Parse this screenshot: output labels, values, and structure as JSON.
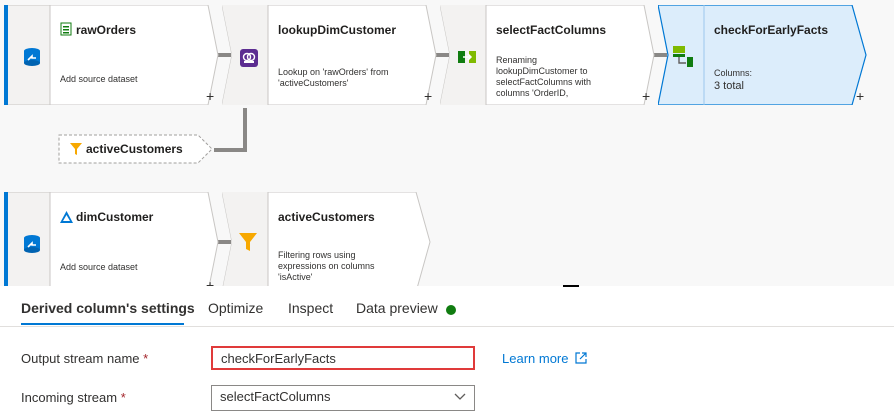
{
  "nodes": {
    "raw_orders": {
      "title": "rawOrders",
      "description": "Add source dataset"
    },
    "lookup": {
      "title": "lookupDimCustomer",
      "description": "Lookup on 'rawOrders' from 'activeCustomers'"
    },
    "select": {
      "title": "selectFactColumns",
      "description": "Renaming lookupDimCustomer to selectFactColumns with columns 'OrderID, CustomerKey, OrderDate..."
    },
    "check": {
      "title": "checkForEarlyFacts",
      "description_label": "Columns:",
      "description_value": "3 total"
    },
    "dim_customer": {
      "title": "dimCustomer",
      "description": "Add source dataset"
    },
    "active_customers": {
      "title": "activeCustomers",
      "description": "Filtering rows using expressions on columns 'isActive'"
    }
  },
  "reference_tag": {
    "label": "activeCustomers"
  },
  "plus_symbol": "+",
  "tabs": [
    {
      "label": "Derived column's settings",
      "active": true
    },
    {
      "label": "Optimize",
      "active": false
    },
    {
      "label": "Inspect",
      "active": false
    },
    {
      "label": "Data preview",
      "active": false
    }
  ],
  "form": {
    "output_stream_label": "Output stream name",
    "output_stream_value": "checkForEarlyFacts",
    "incoming_stream_label": "Incoming stream",
    "incoming_stream_value": "selectFactColumns",
    "required_marker": "*",
    "learn_more": "Learn more"
  },
  "colors": {
    "accent": "#0078d4",
    "selected_node_fill": "#dcedfb",
    "status_green": "#107c10",
    "highlight_border": "#e03a3a"
  }
}
